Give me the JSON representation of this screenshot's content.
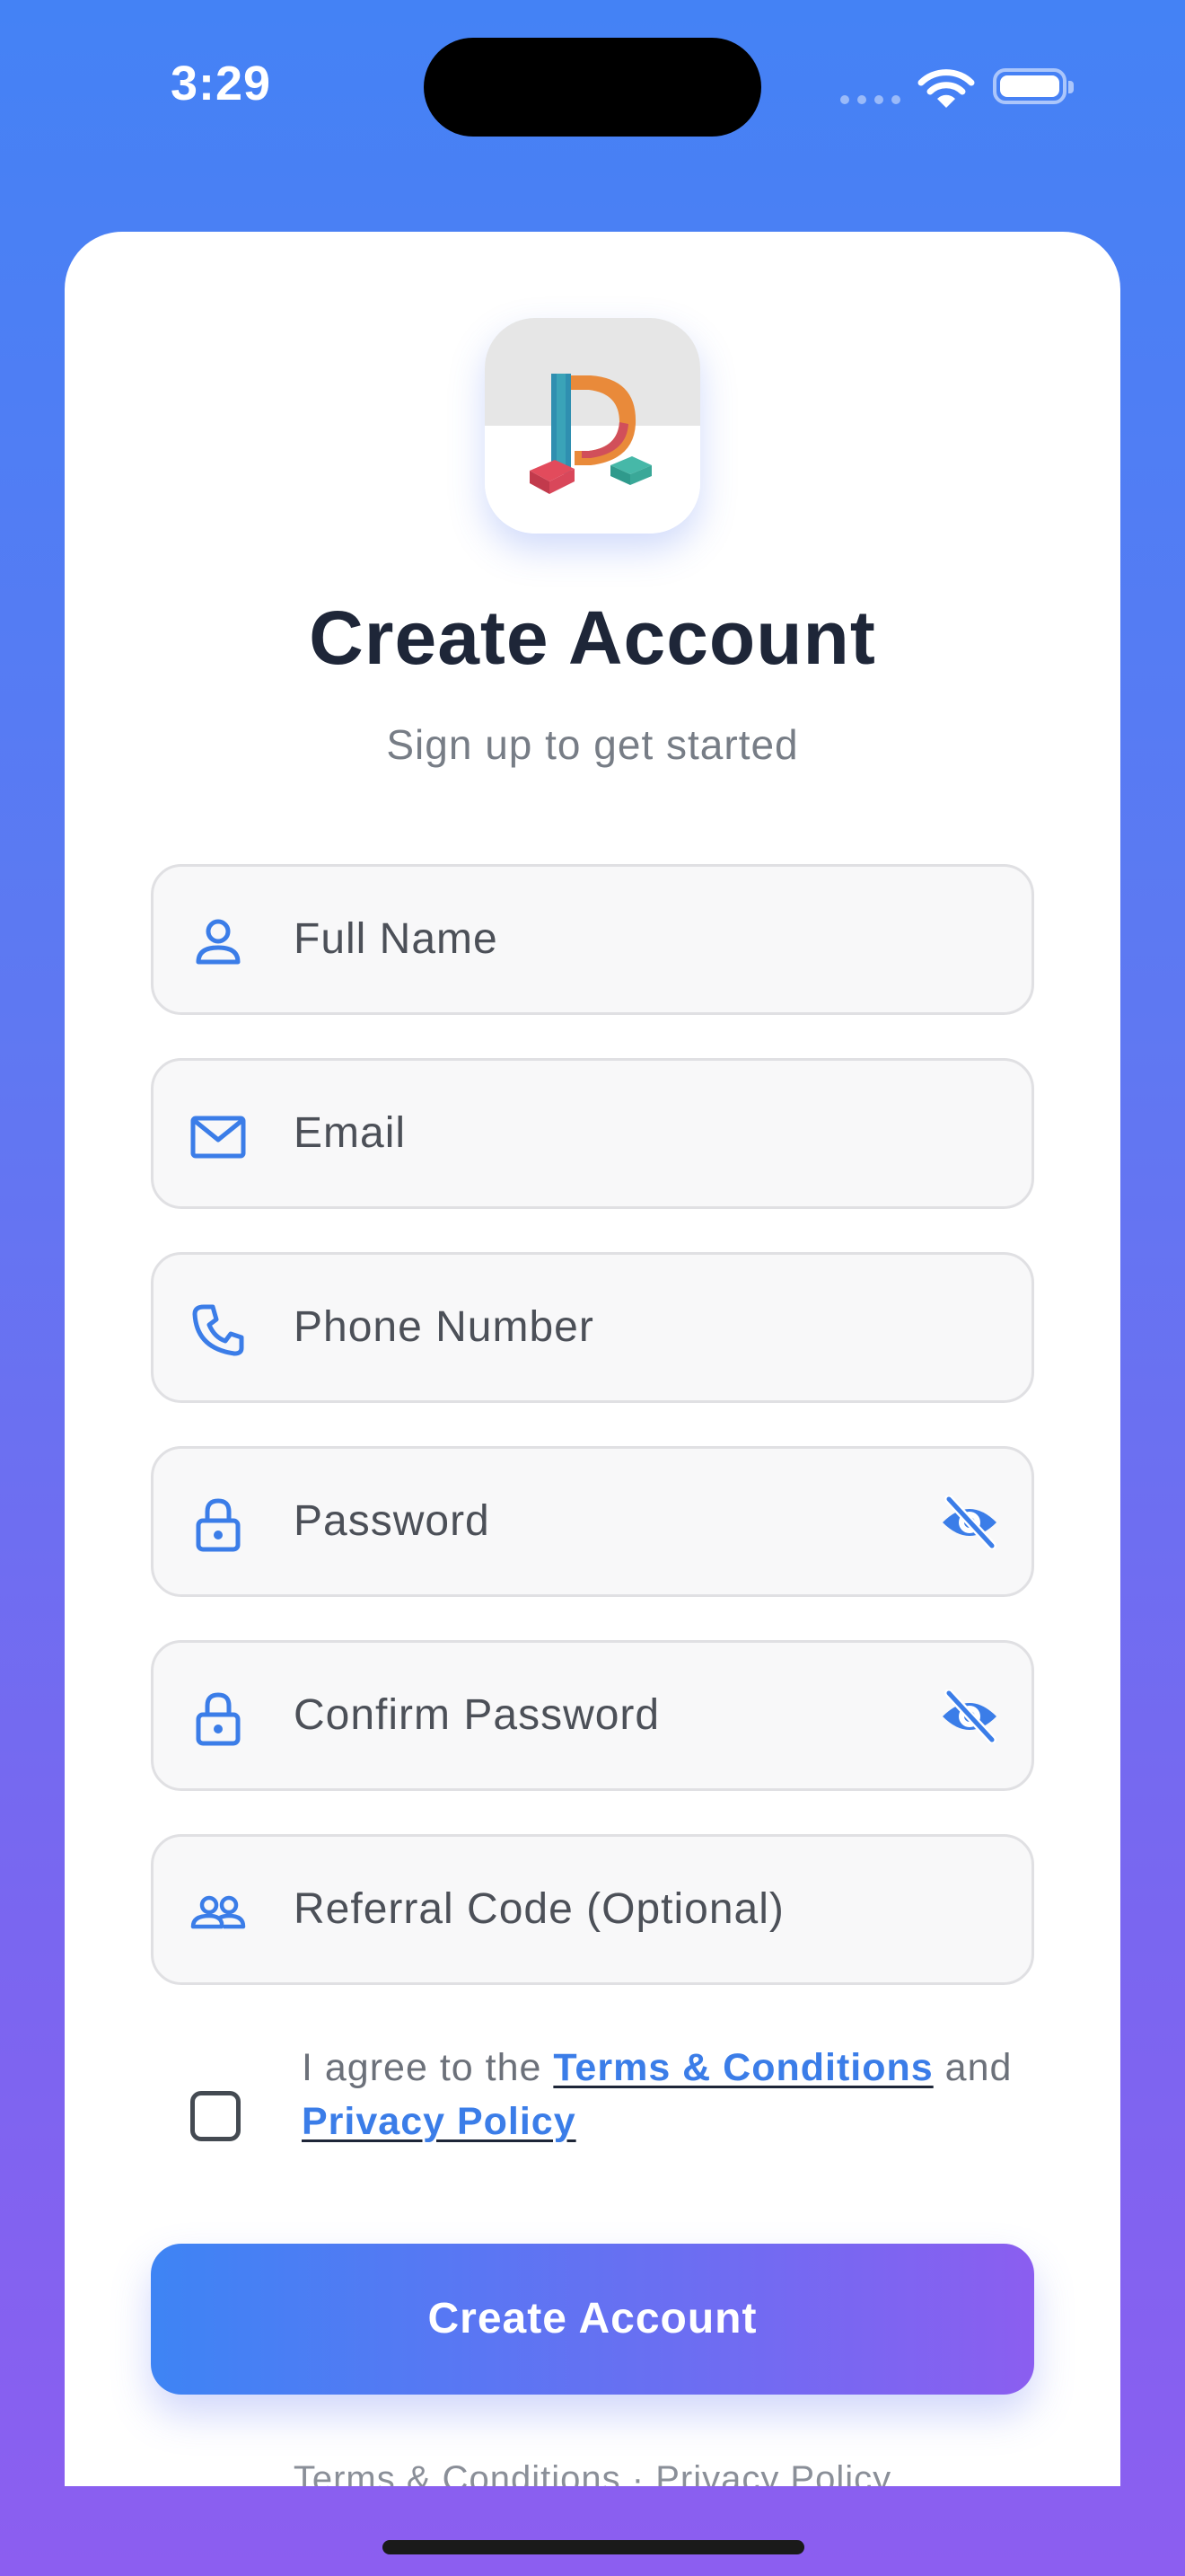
{
  "status_bar": {
    "time": "3:29"
  },
  "header": {
    "title": "Create Account",
    "subtitle": "Sign up to get started"
  },
  "form": {
    "fields": [
      {
        "placeholder": "Full Name",
        "icon": "person-icon",
        "value": ""
      },
      {
        "placeholder": "Email",
        "icon": "mail-icon",
        "value": ""
      },
      {
        "placeholder": "Phone Number",
        "icon": "phone-icon",
        "value": ""
      },
      {
        "placeholder": "Password",
        "icon": "lock-icon",
        "value": "",
        "trailing_icon": "eye-off-icon"
      },
      {
        "placeholder": "Confirm Password",
        "icon": "lock-icon",
        "value": "",
        "trailing_icon": "eye-off-icon"
      },
      {
        "placeholder": "Referral Code (Optional)",
        "icon": "people-icon",
        "value": ""
      }
    ],
    "agreement": {
      "checked": false,
      "prefix": "I agree to the ",
      "terms_link": "Terms & Conditions",
      "middle": " and ",
      "privacy_link": "Privacy Policy"
    },
    "submit_label": "Create Account"
  },
  "footer": {
    "terms_link": "Terms & Conditions",
    "separator": " · ",
    "privacy_link": "Privacy Policy"
  },
  "colors": {
    "accent": "#3b7de8",
    "gradient_start": "#4482f5",
    "gradient_end": "#8c5ef0",
    "title": "#1e2638"
  }
}
